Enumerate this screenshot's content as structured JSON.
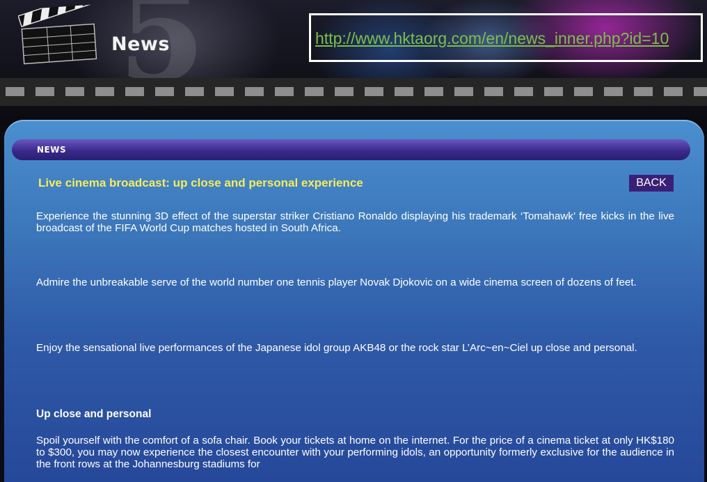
{
  "header": {
    "title": "News",
    "url": "http://www.hktaorg.com/en/news_inner.php?id=10",
    "icons": [
      "clapperboard-icon"
    ]
  },
  "section": {
    "label": "NEWS"
  },
  "article": {
    "headline": "Live cinema broadcast: up close and personal experience",
    "back_label": "BACK",
    "paragraphs": [
      "Experience the stunning 3D effect of the superstar striker Cristiano Ronaldo displaying his trademark ‘Tomahawk’ free kicks in the live broadcast of the FIFA World Cup matches hosted in South Africa.",
      "Admire the unbreakable serve of the world number one tennis player Novak Djokovic on a wide cinema screen of dozens of feet.",
      "Enjoy the sensational live performances of the Japanese idol group AKB48 or the rock star L’Arc~en~Ciel up close and personal."
    ],
    "subheading": "Up close and personal",
    "paragraph_4": "Spoil yourself with the comfort of a sofa chair. Book your tickets at home on the internet. For the price of a cinema ticket at only HK$180 to $300, you may now experience the closest encounter with your performing idols, an opportunity formerly exclusive for the audience in the front rows at the Johannesburg stadiums for"
  },
  "colors": {
    "headline": "#f7ec5a",
    "url": "#7bc04a",
    "back_button": "#3a1f77",
    "panel_top": "#4a8fcf",
    "panel_bottom": "#26489a"
  }
}
